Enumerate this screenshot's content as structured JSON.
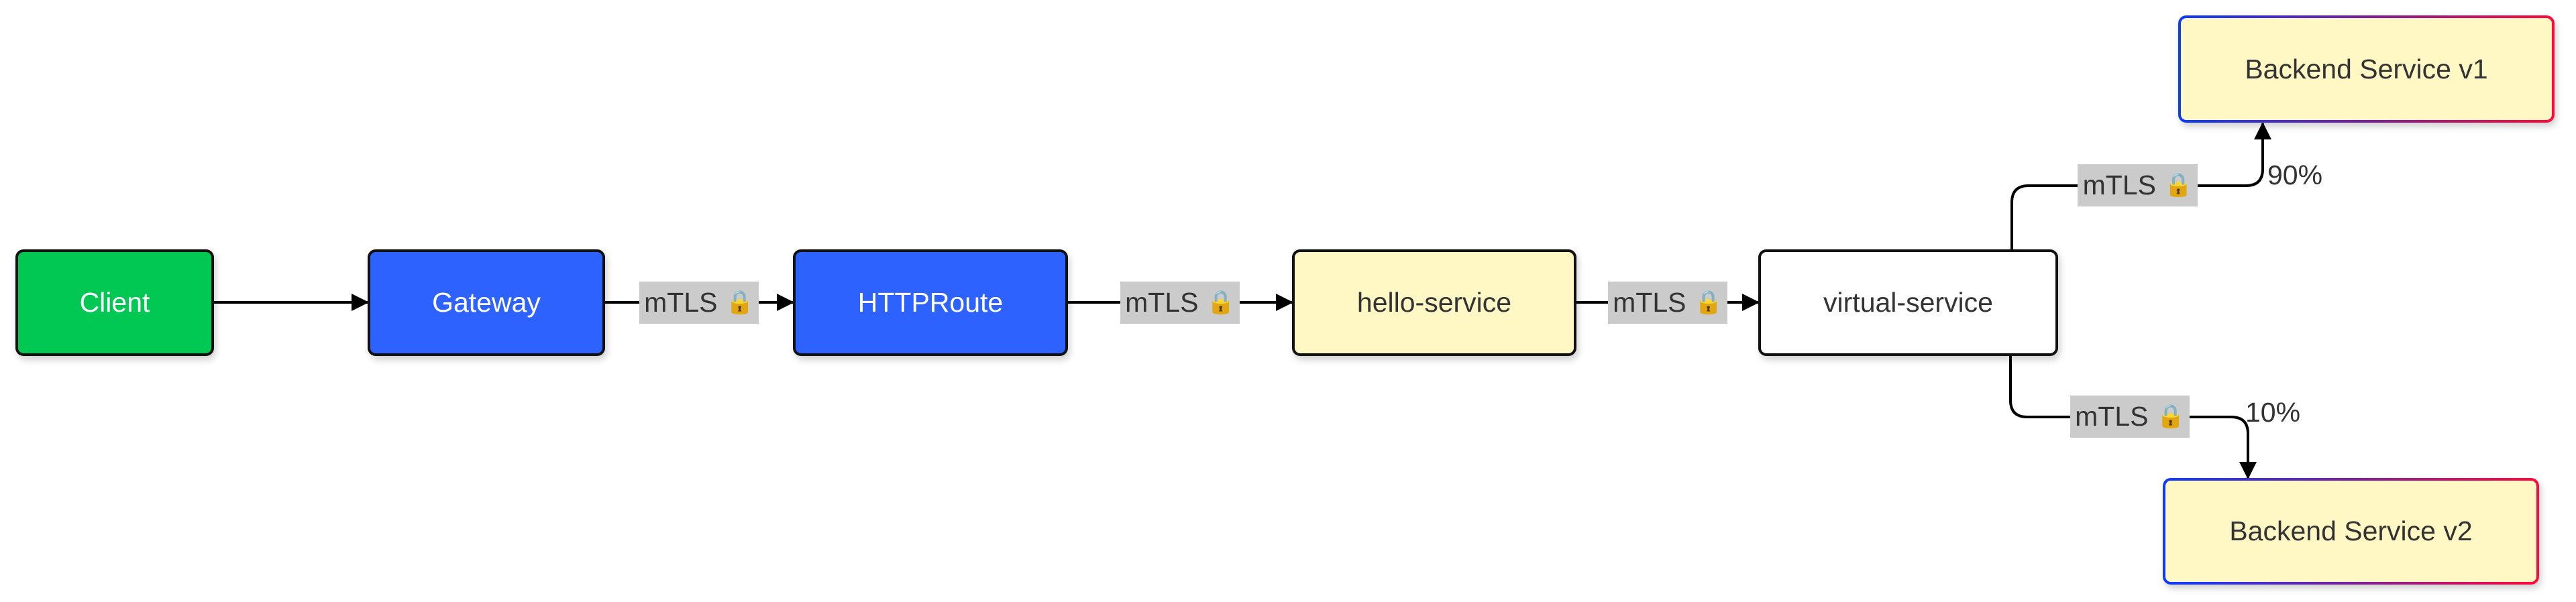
{
  "diagram": {
    "nodes": {
      "client": {
        "label": "Client",
        "fill": "#00c853",
        "text_color": "#ffffff"
      },
      "gateway": {
        "label": "Gateway",
        "fill": "#2d62ff",
        "text_color": "#ffffff"
      },
      "httproute": {
        "label": "HTTPRoute",
        "fill": "#2d62ff",
        "text_color": "#ffffff"
      },
      "hello_service": {
        "label": "hello-service",
        "fill": "#fff8c4",
        "text_color": "#333333"
      },
      "virtual_service": {
        "label": "virtual-service",
        "fill": "#ffffff",
        "text_color": "#333333"
      },
      "backend_v1": {
        "label": "Backend Service v1",
        "fill": "#fff8c4",
        "text_color": "#333333"
      },
      "backend_v2": {
        "label": "Backend Service v2",
        "fill": "#fff8c4",
        "text_color": "#333333"
      }
    },
    "edges": [
      {
        "from": "Client",
        "to": "Gateway",
        "label": ""
      },
      {
        "from": "Gateway",
        "to": "HTTPRoute",
        "label": "mTLS",
        "icon": "lock-icon"
      },
      {
        "from": "HTTPRoute",
        "to": "hello-service",
        "label": "mTLS",
        "icon": "lock-icon"
      },
      {
        "from": "hello-service",
        "to": "virtual-service",
        "label": "mTLS",
        "icon": "lock-icon"
      },
      {
        "from": "virtual-service",
        "to": "Backend Service v1",
        "label": "mTLS",
        "icon": "lock-icon",
        "weight": "90%"
      },
      {
        "from": "virtual-service",
        "to": "Backend Service v2",
        "label": "mTLS",
        "icon": "lock-icon",
        "weight": "10%"
      }
    ],
    "edge_label_text": "mTLS",
    "lock_glyph": "🔒",
    "weights": {
      "v1": "90%",
      "v2": "10%"
    },
    "colors": {
      "line": "#000000",
      "label_bg": "#cbcbcb",
      "gradient_start": "#0a3cff",
      "gradient_end": "#ff0a3c"
    }
  }
}
